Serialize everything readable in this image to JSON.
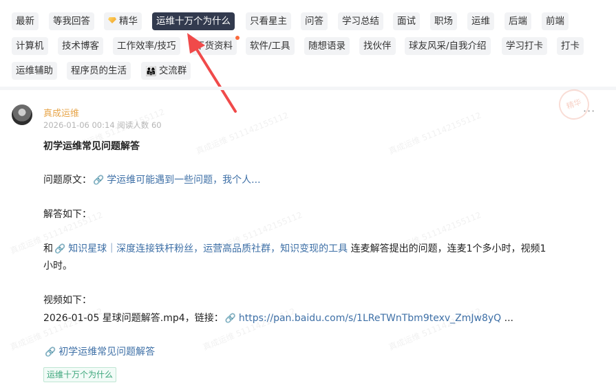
{
  "tags": {
    "row1": [
      "最新",
      "等我回答",
      "精华",
      "运维十万个为什么",
      "只看星主",
      "问答",
      "学习总结",
      "面试",
      "职场",
      "运维",
      "后端",
      "前端"
    ],
    "row2": [
      "计算机",
      "技术博客",
      "工作效率/技巧",
      "干货资料",
      "软件/工具",
      "随想语录",
      "找伙伴",
      "球友风采/自我介绍",
      "学习打卡",
      "打卡"
    ],
    "row3": [
      "运维辅助",
      "程序员的生活",
      "交流群"
    ],
    "active": "运维十万个为什么",
    "jinghua_icon": "diamond-icon",
    "group_icon": "family-emoji-icon",
    "group_emoji": "👨‍👩‍👧"
  },
  "post": {
    "author": "真成运维",
    "date": "2026-01-06 00:14",
    "read_label": "阅读人数 60",
    "more": "···",
    "stamp": "精华",
    "title": "初学运维常见问题解答",
    "question_label": "问题原文：",
    "question_link": "学运维可能遇到一些问题，我个人...",
    "answer_label": "解答如下：",
    "and_prefix": "和",
    "planet_link": "知识星球｜深度连接铁杆粉丝，运营高品质社群，知识变现的工具",
    "line_rest": "连麦解答提出的问题，连麦1个多小时，视频1",
    "line_rest2": "小时。",
    "video_label": "视频如下：",
    "video_file": "2026-01-05 星球问题解答.mp4，链接：",
    "video_link": "https://pan.baidu.com/s/1LReTWnTbm9texv_ZmJw8yQ",
    "video_ellipsis": "...",
    "footer_link": "初学运维常见问题解答",
    "topic_tag": "运维十万个为什么"
  },
  "watermark": "真成运维 511142155112"
}
